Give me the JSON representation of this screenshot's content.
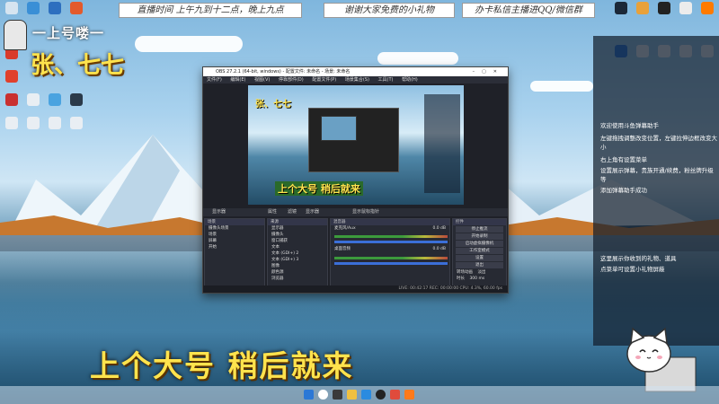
{
  "banners": {
    "schedule": "直播时间 上午九到十二点，晚上九点",
    "thanks": "谢谢大家免费的小礼物",
    "contact": "办卡私信主播进QQ/微信群"
  },
  "streamer": {
    "handle": "一上号喽一",
    "name": "张、七七",
    "caption": "上个大号 稍后就来"
  },
  "right_panel": {
    "lines": [
      "欢迎使用斗鱼弹幕助手",
      "左键拖拽调整改变位置，左键拉伸边框改变大",
      "小",
      "右上角有设置菜单",
      "设置展示弹幕，贵族开通/续费，粉丝牌升级",
      "等",
      "添加弹幕助手成功"
    ],
    "gift_lines": [
      "这里展示你收到的礼物、道具",
      "点菜单可设置小礼物屏蔽"
    ]
  },
  "obs": {
    "title": "OBS 27.2.1 (64-bit, windows) - 配置文件: 未命名 - 场景: 未命名",
    "menu": [
      "文件(F)",
      "编辑(E)",
      "视图(V)",
      "停靠部件(D)",
      "配置文件(P)",
      "场景集合(S)",
      "工具(T)",
      "帮助(H)"
    ],
    "preview_caption": "上个大号 稍后就来",
    "preview_name": "张、七七",
    "strip": {
      "source_label": "显示器",
      "properties": "属性",
      "filters": "滤镜",
      "display": "显示器",
      "show_cursor": "显示鼠标指针"
    },
    "scenes": {
      "header": "场景",
      "items": [
        "摄像头场景",
        "场景",
        "屏幕",
        "开始"
      ]
    },
    "sources": {
      "header": "来源",
      "items": [
        "显示器",
        "摄像头",
        "窗口捕获",
        "文本",
        "文本 (GDI+) 2",
        "文本 (GDI+) 3",
        "图像",
        "颜色源",
        "浏览器",
        "媒体源"
      ]
    },
    "mixer": {
      "header": "混音器",
      "channels": [
        {
          "name": "麦克风/Aux",
          "level": "0.0 dB"
        },
        {
          "name": "桌面音频",
          "level": "0.0 dB"
        }
      ]
    },
    "controls": {
      "header": "控件",
      "buttons": [
        "停止推流",
        "开始录制",
        "启动虚拟摄像机",
        "工作室模式",
        "设置",
        "退出"
      ]
    },
    "transitions": {
      "header": "转场动画",
      "selected": "淡出",
      "duration_label": "时长",
      "duration_value": "300 ms"
    },
    "status": "LIVE: 00:42:17   REC: 00:00:00   CPU: 4.3%, 60.00 fps"
  },
  "taskbar": {
    "icons": [
      "start-icon",
      "search-icon",
      "taskview-icon",
      "explorer-icon",
      "browser-icon",
      "obs-icon",
      "qq-icon",
      "douyu-icon"
    ]
  },
  "colors": {
    "caption_yellow": "#ffe34d",
    "obs_dark": "#1f2128",
    "panel_bg": "#141e2d"
  }
}
